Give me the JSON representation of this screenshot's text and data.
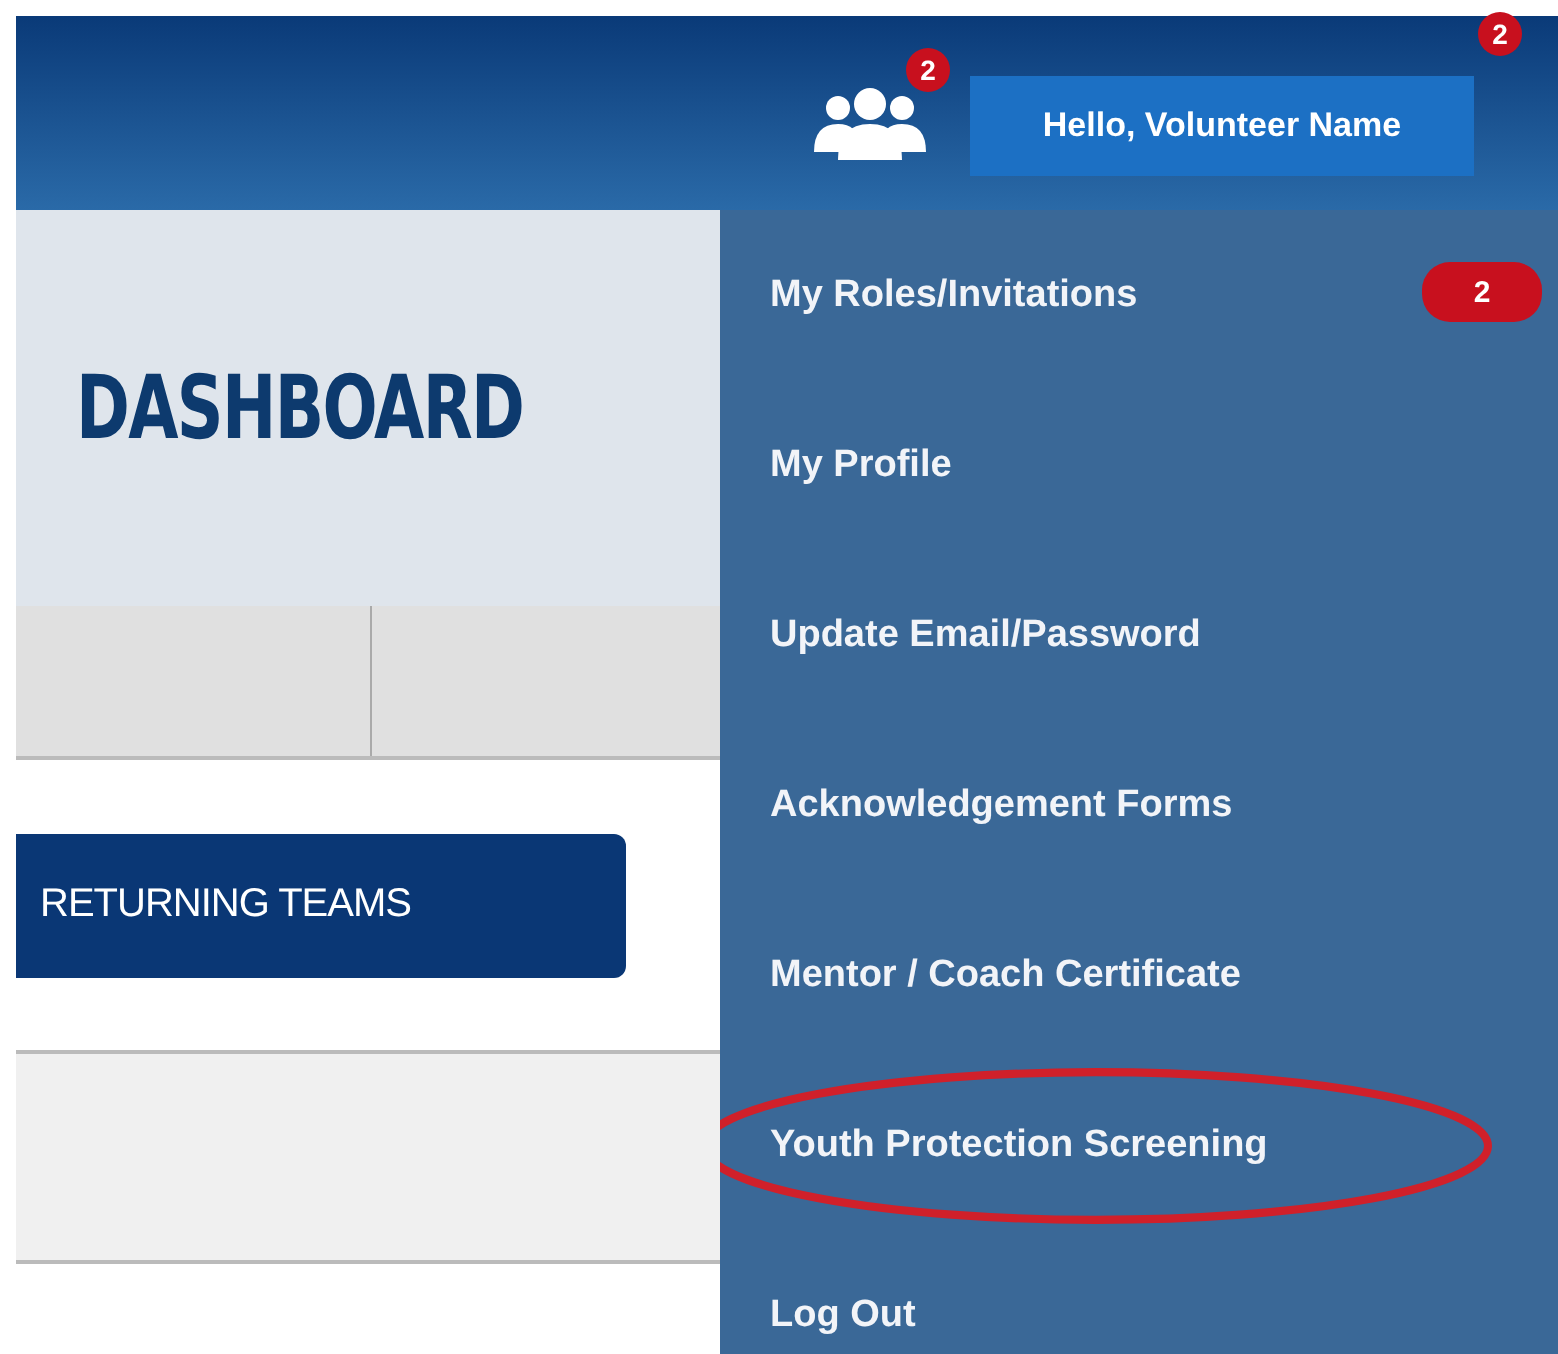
{
  "header": {
    "roles_badge": "2",
    "greeting": "Hello, Volunteer Name",
    "greeting_badge": "2"
  },
  "banner": {
    "title": "DASHBOARD"
  },
  "returning_teams_button": "RETURNING TEAMS",
  "account_menu": {
    "items": [
      {
        "label": "My Roles/Invitations",
        "badge": "2",
        "highlighted": false
      },
      {
        "label": "My Profile",
        "highlighted": false
      },
      {
        "label": "Update Email/Password",
        "highlighted": false
      },
      {
        "label": "Acknowledgement Forms",
        "highlighted": false
      },
      {
        "label": "Mentor / Coach Certificate",
        "highlighted": false
      },
      {
        "label": "Youth Protection Screening",
        "highlighted": true
      },
      {
        "label": "Log Out",
        "highlighted": false
      }
    ]
  }
}
